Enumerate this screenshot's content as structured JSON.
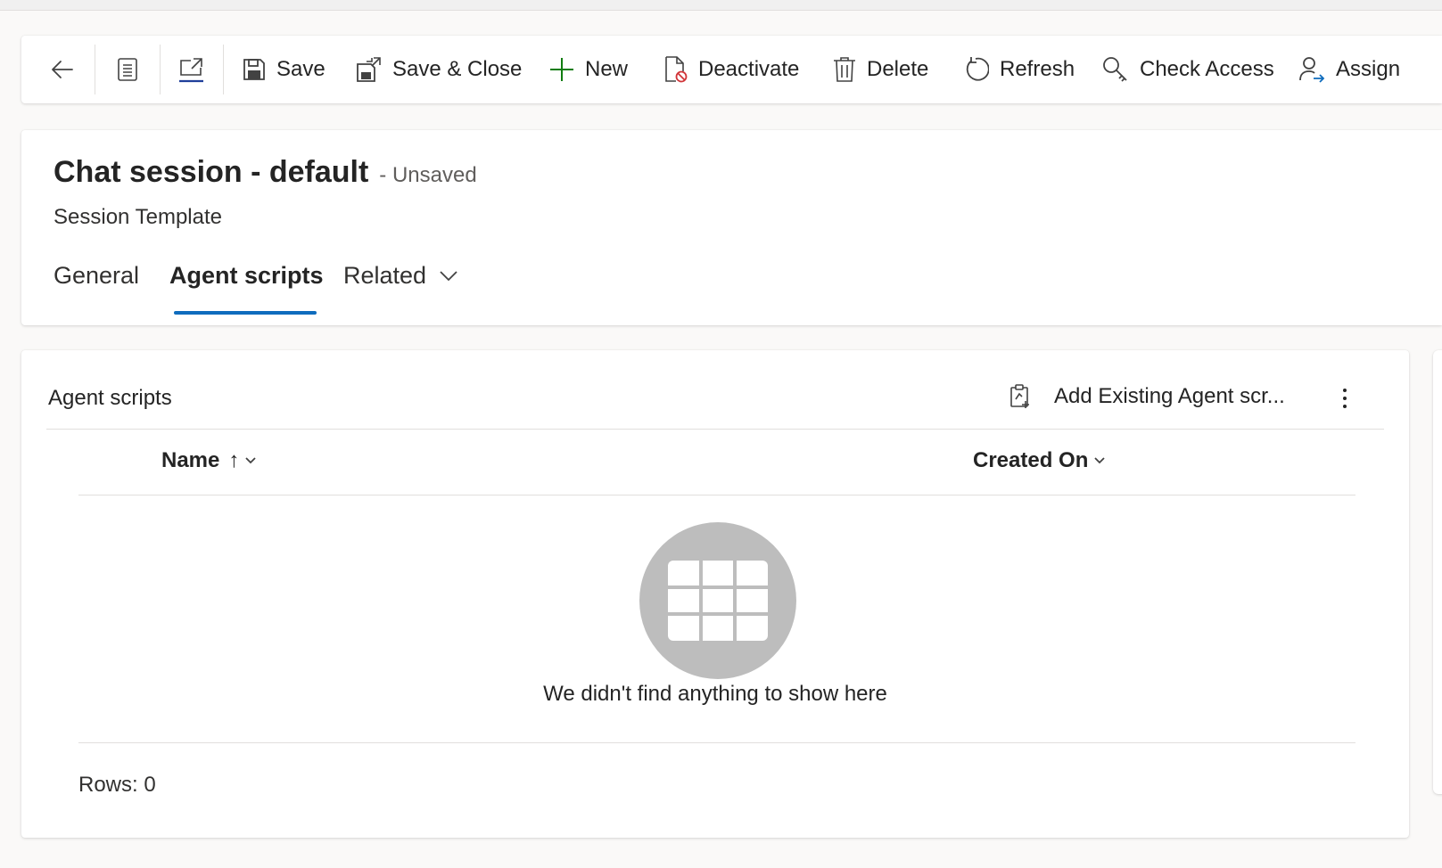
{
  "toolbar": {
    "save": "Save",
    "save_close": "Save & Close",
    "new": "New",
    "deactivate": "Deactivate",
    "delete": "Delete",
    "refresh": "Refresh",
    "check_access": "Check Access",
    "assign": "Assign"
  },
  "record": {
    "title": "Chat session - default",
    "state": "- Unsaved",
    "entity": "Session Template"
  },
  "tabs": [
    {
      "label": "General"
    },
    {
      "label": "Agent scripts"
    },
    {
      "label": "Related"
    }
  ],
  "active_tab": "Agent scripts",
  "subgrid": {
    "title": "Agent scripts",
    "add_existing": "Add Existing Agent scr...",
    "columns": [
      {
        "label": "Name",
        "sort": "↑"
      },
      {
        "label": "Created On"
      }
    ],
    "empty_message": "We didn't find anything to show here",
    "rows_label": "Rows: 0"
  },
  "colors": {
    "accent": "#0f6cbd",
    "new_icon": "#107c10",
    "deactivate_badge": "#d13438"
  }
}
